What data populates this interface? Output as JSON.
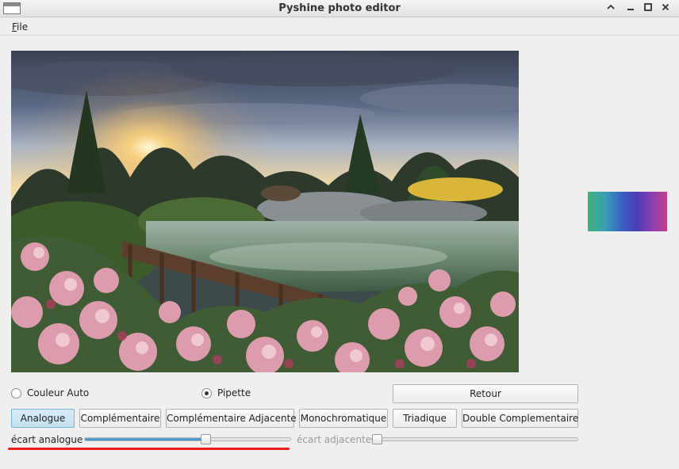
{
  "window": {
    "title": "Pyshine photo editor"
  },
  "menu": {
    "file_first": "F",
    "file_rest": "ile"
  },
  "controls": {
    "radio_auto": {
      "label": "Couleur Auto",
      "checked": false
    },
    "radio_pipette": {
      "label": "Pipette",
      "checked": true
    },
    "retour_label": "Retour",
    "harmony_buttons": [
      {
        "label": "Analogue",
        "active": true
      },
      {
        "label": "Complémentaire",
        "active": false
      },
      {
        "label": "Complémentaire Adjacente",
        "active": false
      },
      {
        "label": "Monochromatique",
        "active": false
      },
      {
        "label": "Triadique",
        "active": false
      },
      {
        "label": "Double Complementaire",
        "active": false
      }
    ],
    "slider_analogue": {
      "label": "écart analogue",
      "value": 0.59,
      "enabled": true
    },
    "slider_adjacente": {
      "label": "écart adjacente",
      "value": 0.0,
      "enabled": false
    }
  },
  "colors": {
    "annotation_underline": "#ee1c1c",
    "slider_fill": "#3e8cc3"
  },
  "icons": [
    "window-icon",
    "chevron-up-icon",
    "minimize-icon",
    "maximize-icon",
    "close-icon"
  ]
}
